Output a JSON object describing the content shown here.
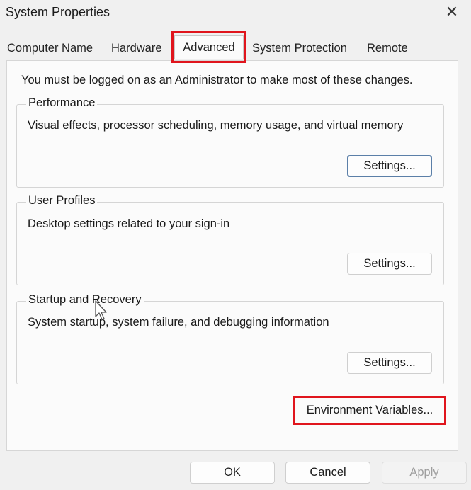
{
  "window": {
    "title": "System Properties",
    "close_icon": "close-icon"
  },
  "tabs": [
    {
      "label": "Computer Name"
    },
    {
      "label": "Hardware"
    },
    {
      "label": "Advanced",
      "active": true
    },
    {
      "label": "System Protection"
    },
    {
      "label": "Remote"
    }
  ],
  "notice": "You must be logged on as an Administrator to make most of these changes.",
  "groups": {
    "performance": {
      "legend": "Performance",
      "description": "Visual effects, processor scheduling, memory usage, and virtual memory",
      "button": "Settings..."
    },
    "user_profiles": {
      "legend": "User Profiles",
      "description": "Desktop settings related to your sign-in",
      "button": "Settings..."
    },
    "startup_recovery": {
      "legend": "Startup and Recovery",
      "description": "System startup, system failure, and debugging information",
      "button": "Settings..."
    }
  },
  "env_button": "Environment Variables...",
  "footer": {
    "ok": "OK",
    "cancel": "Cancel",
    "apply": "Apply"
  },
  "colors": {
    "highlight": "#e0151d",
    "background": "#f0f0f0",
    "panel": "#fbfbfb",
    "disabled_text": "#9e9e9e"
  }
}
